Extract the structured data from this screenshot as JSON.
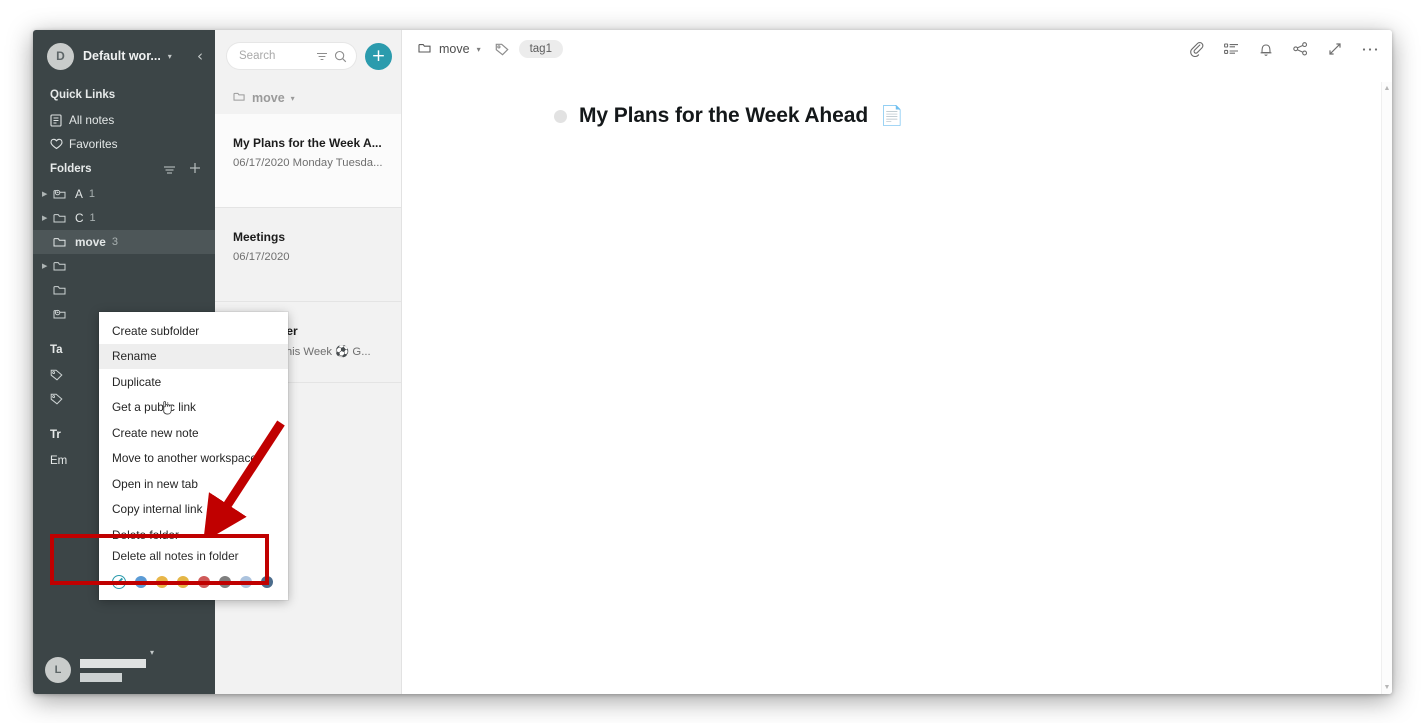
{
  "sidebar": {
    "workspace": {
      "avatar_letter": "D",
      "name": "Default wor...",
      "caret": "▾",
      "collapse_icon": "‹"
    },
    "quick_links_title": "Quick Links",
    "quick_links": [
      {
        "label": "All notes",
        "icon": "notes-icon"
      },
      {
        "label": "Favorites",
        "icon": "heart-icon"
      }
    ],
    "folders_title": "Folders",
    "folders": [
      {
        "label": "A",
        "count": "1",
        "expandable": true,
        "shared": true,
        "selected": false
      },
      {
        "label": "C",
        "count": "1",
        "expandable": true,
        "shared": false,
        "selected": false
      },
      {
        "label": "move",
        "count": "3",
        "expandable": false,
        "shared": false,
        "selected": true
      },
      {
        "label": "",
        "count": "",
        "expandable": true,
        "shared": false,
        "selected": false
      },
      {
        "label": "",
        "count": "",
        "expandable": false,
        "shared": false,
        "selected": false
      },
      {
        "label": "",
        "count": "",
        "expandable": false,
        "shared": true,
        "selected": false
      }
    ],
    "tags_title": "Ta",
    "tags": [
      {
        "label": ""
      },
      {
        "label": ""
      }
    ],
    "trash_title": "Tr",
    "empty_trash_title": "Em",
    "user": {
      "avatar_letter": "L",
      "caret": "▾"
    }
  },
  "notelist": {
    "search": {
      "placeholder": "Search",
      "filter_icon": "filter-icon",
      "search_icon": "search-icon"
    },
    "add_label": "+",
    "folder_head": {
      "label": "move",
      "caret": "▾"
    },
    "notes": [
      {
        "title": "My Plans for the Week A...",
        "snippet": "06/17/2020 Monday Tuesda...",
        "active": true
      },
      {
        "title": "Meetings",
        "snippet": "06/17/2020",
        "active": false
      },
      {
        "title": "am Planner",
        "snippet": "'20/2020 This Week ⚽ G...",
        "active": false
      }
    ]
  },
  "main": {
    "breadcrumb": {
      "folder": "move",
      "caret": "▾"
    },
    "tag_chip": "tag1",
    "toolbar_icons": [
      "attachment-icon",
      "outline-icon",
      "reminder-bell-icon",
      "share-icon",
      "expand-icon",
      "more-icon"
    ],
    "document": {
      "title": "My Plans for the Week Ahead",
      "emoji": "📄"
    },
    "scroll_up": "▲",
    "scroll_down": "▼"
  },
  "context_menu": {
    "items": [
      {
        "label": "Create subfolder",
        "highlighted": false,
        "clipped": false
      },
      {
        "label": "Rename",
        "highlighted": true,
        "clipped": false
      },
      {
        "label": "Duplicate",
        "highlighted": false,
        "clipped": false
      },
      {
        "label": "Get a public link",
        "highlighted": false,
        "clipped": false
      },
      {
        "label": "Create new note",
        "highlighted": false,
        "clipped": false
      },
      {
        "label": "Move to another workspace",
        "highlighted": false,
        "clipped": false
      },
      {
        "label": "Open in new tab",
        "highlighted": false,
        "clipped": false
      },
      {
        "label": "Copy internal link",
        "highlighted": false,
        "clipped": false
      },
      {
        "label": "Delete folder",
        "highlighted": false,
        "clipped": false
      },
      {
        "label": "Delete all notes in folder",
        "highlighted": false,
        "clipped": true
      }
    ],
    "colors": [
      {
        "name": "no-color",
        "hex": "#2b9bad"
      },
      {
        "name": "blue",
        "hex": "#5b9bd5"
      },
      {
        "name": "amber",
        "hex": "#e8b648"
      },
      {
        "name": "gold",
        "hex": "#e4b646"
      },
      {
        "name": "red",
        "hex": "#cf5a59"
      },
      {
        "name": "gray",
        "hex": "#7f7f7f"
      },
      {
        "name": "light-blue",
        "hex": "#acc3de"
      },
      {
        "name": "slate-blue",
        "hex": "#4b6c8c"
      }
    ]
  },
  "annotations": {
    "arrow_color": "#c00000",
    "box_color": "#c00000"
  }
}
